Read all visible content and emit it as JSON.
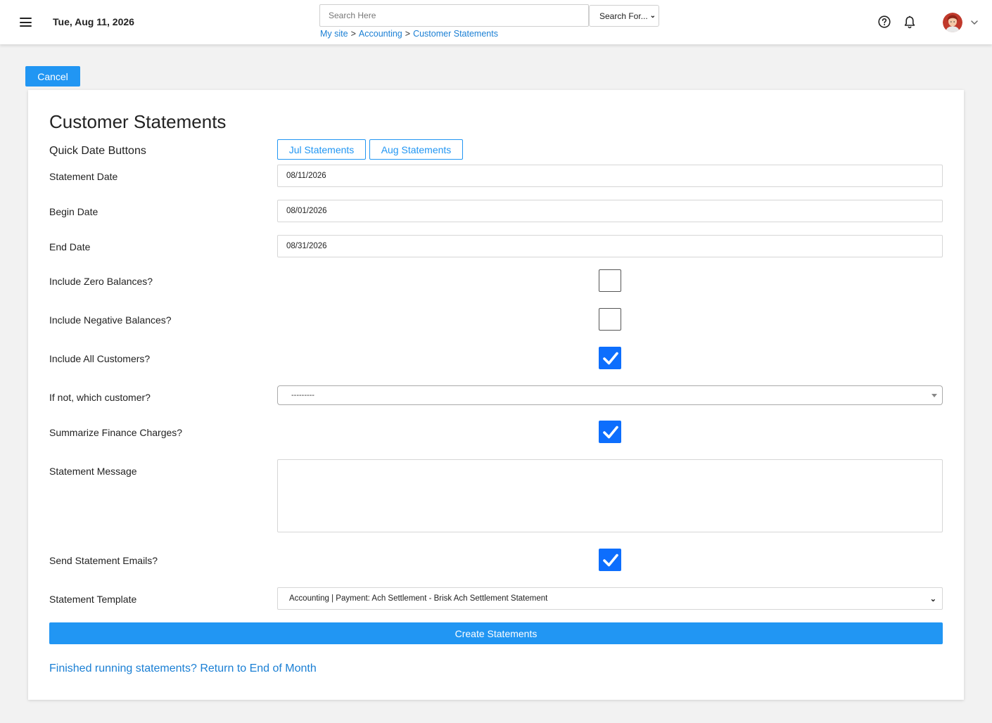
{
  "header": {
    "date": "Tue, Aug 11, 2026",
    "search": {
      "placeholder": "Search Here",
      "value": ""
    },
    "search_scope": "Search For...",
    "breadcrumb": {
      "items": [
        "My site",
        "Accounting",
        "Customer Statements"
      ],
      "separator": ">"
    },
    "icons": [
      "menu-icon",
      "help-icon",
      "bell-icon",
      "avatar",
      "chevron-down-icon"
    ]
  },
  "toolbar": {
    "cancel_label": "Cancel"
  },
  "form": {
    "title": "Customer Statements",
    "quick_date": {
      "label": "Quick Date Buttons",
      "buttons": [
        "Jul Statements",
        "Aug Statements"
      ]
    },
    "statement_date": {
      "label": "Statement Date",
      "value": "08/11/2026"
    },
    "begin_date": {
      "label": "Begin Date",
      "value": "08/01/2026"
    },
    "end_date": {
      "label": "End Date",
      "value": "08/31/2026"
    },
    "include_zero": {
      "label": "Include Zero Balances?",
      "checked": false
    },
    "include_negative": {
      "label": "Include Negative Balances?",
      "checked": false
    },
    "include_all": {
      "label": "Include All Customers?",
      "checked": true
    },
    "which_customer": {
      "label": "If not, which customer?",
      "value": "---------"
    },
    "summarize_finance": {
      "label": "Summarize Finance Charges?",
      "checked": true
    },
    "message": {
      "label": "Statement Message",
      "value": ""
    },
    "send_emails": {
      "label": "Send Statement Emails?",
      "checked": true
    },
    "template": {
      "label": "Statement Template",
      "value": "Accounting | Payment: Ach Settlement - Brisk Ach Settlement Statement"
    },
    "create_label": "Create Statements",
    "return_link": "Finished running statements? Return to End of Month"
  },
  "colors": {
    "accent": "#2196f3",
    "link": "#1a7fd4",
    "checkbox_checked": "#0d6efd",
    "background": "#f2f2f2"
  }
}
